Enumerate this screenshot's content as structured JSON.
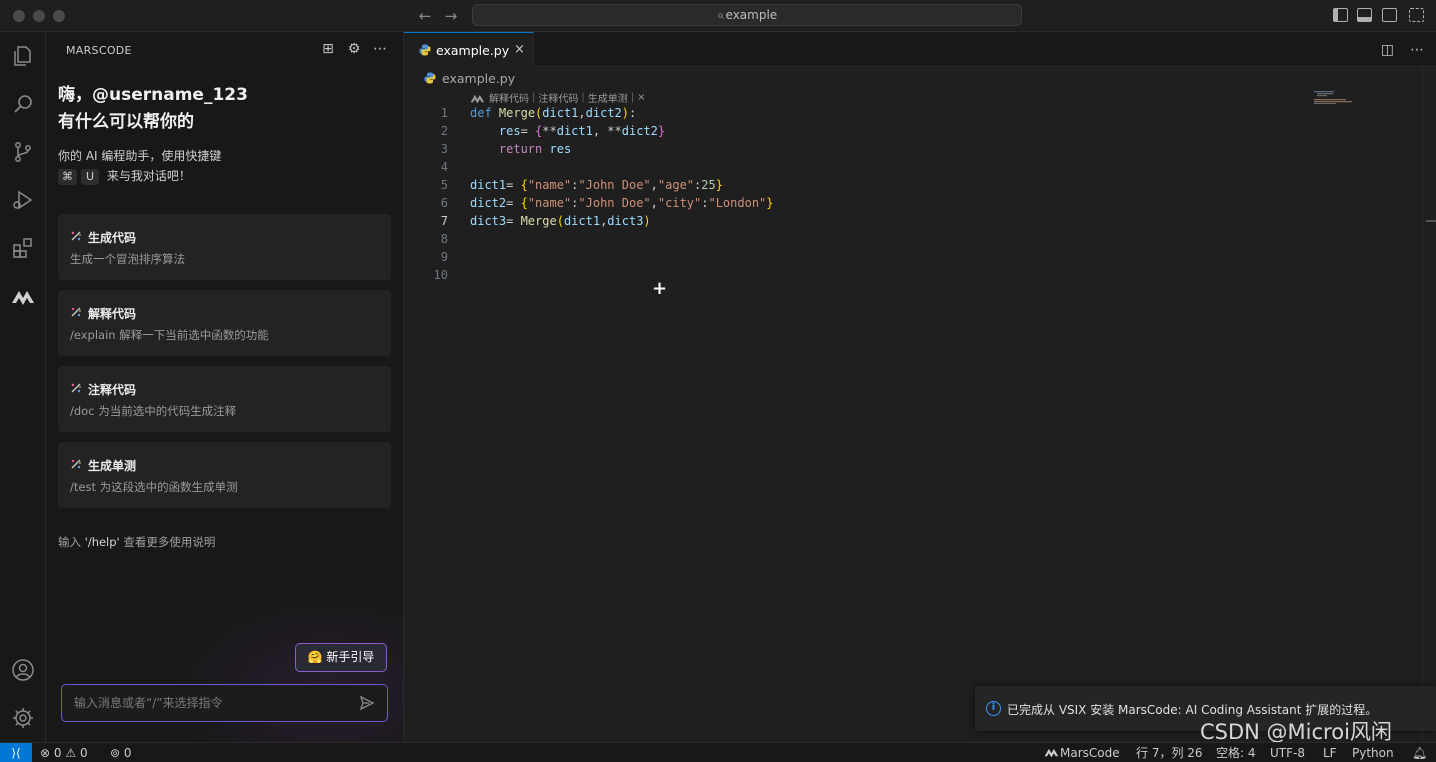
{
  "titlebar": {
    "search_text": "example"
  },
  "sidebar": {
    "header": "MARSCODE",
    "greeting_line1": "嗨，@username_123",
    "greeting_line2": "有什么可以帮你的",
    "intro_line1": "你的 AI 编程助手，使用快捷键",
    "shortcut_key1": "⌘",
    "shortcut_key2": "U",
    "intro_line2": "来与我对话吧！",
    "cards": [
      {
        "title": "生成代码",
        "desc": "生成一个冒泡排序算法"
      },
      {
        "title": "解释代码",
        "desc": "/explain 解释一下当前选中函数的功能"
      },
      {
        "title": "注释代码",
        "desc": "/doc 为当前选中的代码生成注释"
      },
      {
        "title": "生成单测",
        "desc": "/test 为这段选中的函数生成单测"
      }
    ],
    "help_prefix": "输入",
    "help_cmd": "'/help'",
    "help_suffix": "查看更多使用说明",
    "guide_button": "🤗 新手引导",
    "chat_placeholder": "输入消息或者“/”来选择指令"
  },
  "editor": {
    "tab_label": "example.py",
    "breadcrumb": "example.py",
    "codelens": [
      "解释代码",
      "注释代码",
      "生成单测"
    ],
    "line_numbers": [
      "1",
      "2",
      "3",
      "4",
      "5",
      "6",
      "7",
      "8",
      "9",
      "10"
    ],
    "active_line": "7"
  },
  "notification": {
    "message": "已完成从 VSIX 安装 MarsCode: AI Coding Assistant 扩展的过程。"
  },
  "statusbar": {
    "errors": "0",
    "warnings": "0",
    "ports": "0",
    "marscode": "MarsCode",
    "position": "行 7，列 26",
    "spaces": "空格: 4",
    "encoding": "UTF-8",
    "eol": "LF",
    "language": "Python"
  },
  "watermark": "CSDN @Microi风闲",
  "colors": {
    "accent": "#0078d4",
    "tab_border": "#0078d4",
    "guide_border": "#8a5ed0",
    "input_border": "#6a5acd"
  }
}
